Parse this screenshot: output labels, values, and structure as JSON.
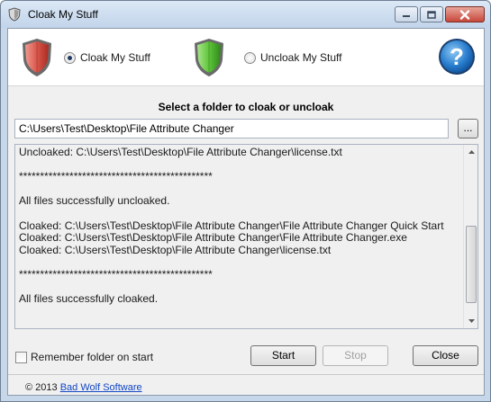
{
  "window": {
    "title": "Cloak My Stuff"
  },
  "header": {
    "option_cloak": "Cloak My Stuff",
    "option_uncloak": "Uncloak My Stuff",
    "selected_option": "cloak"
  },
  "folder": {
    "heading": "Select a folder to cloak or uncloak",
    "path": "C:\\Users\\Test\\Desktop\\File Attribute Changer",
    "browse_label": "..."
  },
  "log": {
    "lines": [
      "Uncloaked: C:\\Users\\Test\\Desktop\\File Attribute Changer\\license.txt",
      "",
      "**********************************************",
      "",
      "All files successfully uncloaked.",
      "",
      "Cloaked: C:\\Users\\Test\\Desktop\\File Attribute Changer\\File Attribute Changer Quick Start",
      "Cloaked: C:\\Users\\Test\\Desktop\\File Attribute Changer\\File Attribute Changer.exe",
      "Cloaked: C:\\Users\\Test\\Desktop\\File Attribute Changer\\license.txt",
      "",
      "**********************************************",
      "",
      "All files successfully cloaked.",
      "",
      ""
    ]
  },
  "options": {
    "remember_label": "Remember folder on start",
    "remember_checked": false
  },
  "buttons": {
    "start": "Start",
    "stop": "Stop",
    "close": "Close"
  },
  "footer": {
    "copyright": "© 2013",
    "link_text": "Bad Wolf Software"
  }
}
